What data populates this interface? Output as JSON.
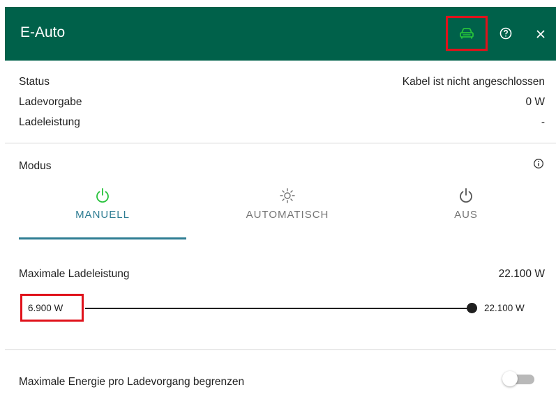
{
  "header": {
    "title": "E-Auto",
    "bg_color": "#00614a",
    "icons": {
      "car": "car-icon",
      "help": "help-circle-icon",
      "close": "close-icon"
    }
  },
  "info": {
    "rows": [
      {
        "label": "Status",
        "value": "Kabel ist nicht angeschlossen"
      },
      {
        "label": "Ladevorgabe",
        "value": "0 W"
      },
      {
        "label": "Ladeleistung",
        "value": "-"
      }
    ]
  },
  "modus": {
    "label": "Modus",
    "tabs": [
      {
        "label": "MANUELL",
        "icon": "power-icon",
        "active": true
      },
      {
        "label": "AUTOMATISCH",
        "icon": "sun-icon",
        "active": false
      },
      {
        "label": "AUS",
        "icon": "power-icon",
        "active": false
      }
    ],
    "accent_color": "#2f7d93"
  },
  "power": {
    "label": "Maximale Ladeleistung",
    "value": "22.100 W",
    "slider": {
      "min_label": "6.900 W",
      "max_label": "22.100 W",
      "level_fraction": 1.0
    }
  },
  "energy_limit": {
    "label": "Maximale Energie pro Ladevorgang begrenzen",
    "enabled": false
  },
  "colors": {
    "highlight": "#e0121b",
    "car_icon": "#27c23b"
  }
}
